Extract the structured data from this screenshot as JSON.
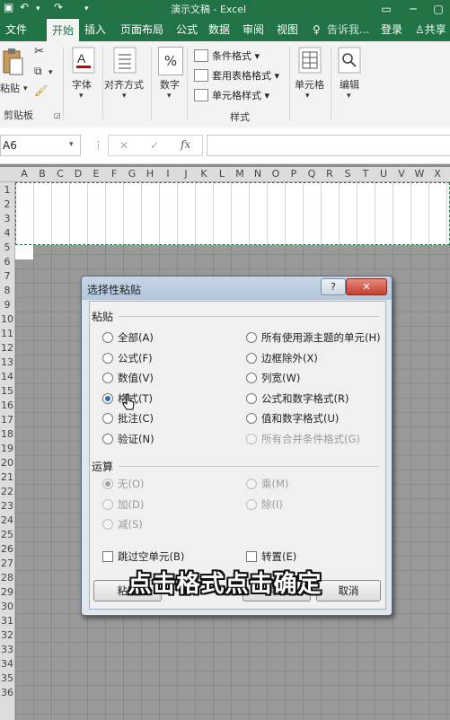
{
  "window": {
    "title": "演示文稿 - Excel"
  },
  "tabs": [
    {
      "label": "文件"
    },
    {
      "label": "开始"
    },
    {
      "label": "插入"
    },
    {
      "label": "页面布局"
    },
    {
      "label": "公式"
    },
    {
      "label": "数据"
    },
    {
      "label": "审阅"
    },
    {
      "label": "视图"
    }
  ],
  "tellme": "告诉我...",
  "login": "登录",
  "share": "共享",
  "ribbon": {
    "paste": "粘贴",
    "clipboard": "剪贴板",
    "font": "字体",
    "align": "对齐方式",
    "number": "数字",
    "number_symbol": "%",
    "cond_format": "条件格式 ▾",
    "table_format": "套用表格格式 ▾",
    "cell_style": "单元格样式 ▾",
    "styles": "样式",
    "cells": "单元格",
    "edit": "编辑"
  },
  "formula_bar": {
    "name_box": "A6",
    "cancel": "✕",
    "enter": "✓",
    "fx": "fx"
  },
  "columns": [
    "A",
    "B",
    "C",
    "D",
    "E",
    "F",
    "G",
    "H",
    "I",
    "J",
    "K",
    "L",
    "M",
    "N",
    "O",
    "P",
    "Q",
    "R",
    "S",
    "T",
    "U",
    "V",
    "W",
    "X"
  ],
  "rows": [
    "1",
    "2",
    "3",
    "4",
    "5",
    "6",
    "7",
    "8",
    "9",
    "10",
    "11",
    "12",
    "13",
    "14",
    "15",
    "16",
    "17",
    "18",
    "19",
    "20",
    "21",
    "22",
    "23",
    "24",
    "25",
    "26",
    "27",
    "28",
    "29",
    "30",
    "31",
    "32",
    "33",
    "34",
    "35",
    "36"
  ],
  "dialog": {
    "title": "选择性粘贴",
    "help": "?",
    "close": "✕",
    "paste_section": "粘贴",
    "paste_left": [
      {
        "label": "全部(A)",
        "checked": false
      },
      {
        "label": "公式(F)",
        "checked": false
      },
      {
        "label": "数值(V)",
        "checked": false
      },
      {
        "label": "格式(T)",
        "checked": true
      },
      {
        "label": "批注(C)",
        "checked": false
      },
      {
        "label": "验证(N)",
        "checked": false
      }
    ],
    "paste_right": [
      {
        "label": "所有使用源主题的单元(H)",
        "disabled": false
      },
      {
        "label": "边框除外(X)",
        "disabled": false
      },
      {
        "label": "列宽(W)",
        "disabled": false
      },
      {
        "label": "公式和数字格式(R)",
        "disabled": false
      },
      {
        "label": "值和数字格式(U)",
        "disabled": false
      },
      {
        "label": "所有合并条件格式(G)",
        "disabled": true
      }
    ],
    "op_section": "运算",
    "op_left": [
      {
        "label": "无(O)",
        "checked": true
      },
      {
        "label": "加(D)",
        "checked": false
      },
      {
        "label": "减(S)",
        "checked": false
      }
    ],
    "op_right": [
      {
        "label": "乘(M)"
      },
      {
        "label": "除(I)"
      }
    ],
    "skip_blanks": "跳过空单元(B)",
    "transpose": "转置(E)",
    "paste_link": "粘贴",
    "ok": "确定",
    "cancel": "取消"
  },
  "subtitle": "点击格式点击确定"
}
